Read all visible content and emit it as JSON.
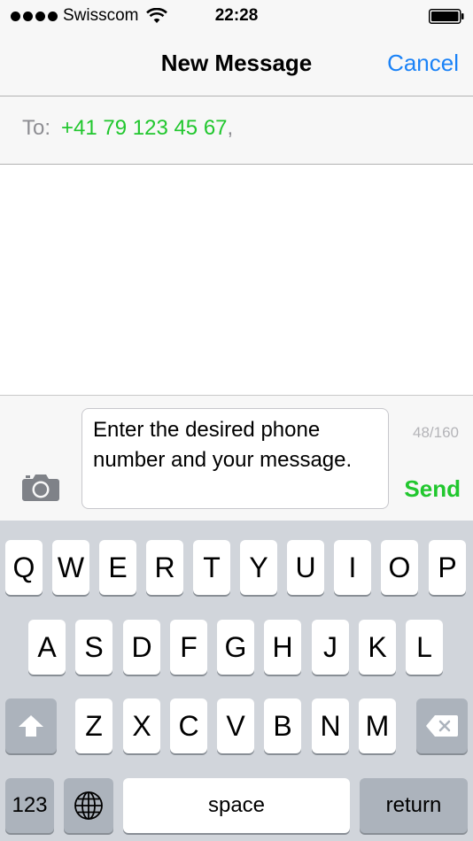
{
  "status_bar": {
    "carrier": "Swisscom",
    "time": "22:28",
    "signal_icon": "signal-dots-icon",
    "wifi_icon": "wifi-icon",
    "battery_icon": "battery-icon"
  },
  "nav": {
    "title": "New Message",
    "cancel": "Cancel"
  },
  "recipient": {
    "label": "To:",
    "value": "+41 79 123 45 67",
    "separator": ","
  },
  "composer": {
    "camera_icon": "camera-icon",
    "message": "Enter the desired phone number and your message.",
    "counter": "48/160",
    "send": "Send"
  },
  "keyboard": {
    "row1": [
      "Q",
      "W",
      "E",
      "R",
      "T",
      "Y",
      "U",
      "I",
      "O",
      "P"
    ],
    "row2": [
      "A",
      "S",
      "D",
      "F",
      "G",
      "H",
      "J",
      "K",
      "L"
    ],
    "row3": [
      "Z",
      "X",
      "C",
      "V",
      "B",
      "N",
      "M"
    ],
    "shift_icon": "shift-icon",
    "delete_icon": "delete-icon",
    "globe_icon": "globe-icon",
    "numbers": "123",
    "space": "space",
    "return": "return"
  },
  "colors": {
    "accent_blue": "#1a82f7",
    "accent_green": "#21c72e",
    "keyboard_bg": "#d1d5db"
  }
}
